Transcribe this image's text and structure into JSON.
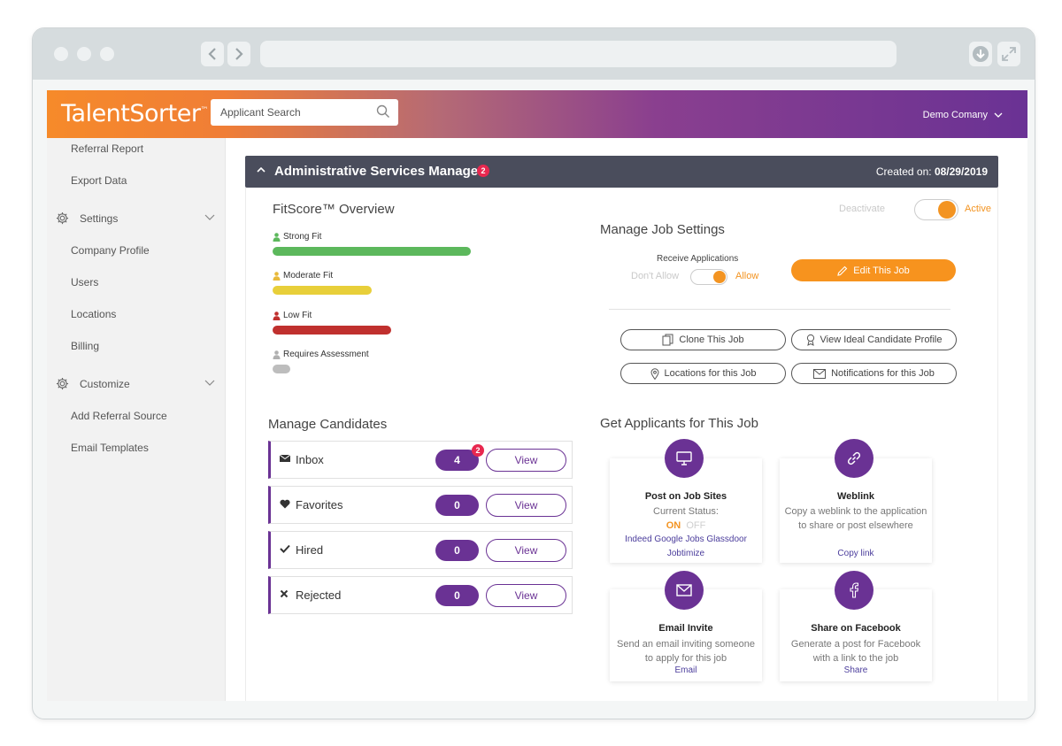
{
  "header": {
    "logo": "TalentSorter",
    "logo_tm": "™",
    "search_placeholder": "Applicant Search",
    "company": "Demo Comany"
  },
  "sidebar": {
    "items": [
      "Referral Report",
      "Export Data"
    ],
    "settings": {
      "label": "Settings",
      "items": [
        "Company Profile",
        "Users",
        "Locations",
        "Billing"
      ]
    },
    "customize": {
      "label": "Customize",
      "items": [
        "Add Referral Source",
        "Email Templates"
      ]
    }
  },
  "job": {
    "title": "Administrative Services Manager",
    "badge": "2",
    "created_label": "Created on:",
    "created_date": "08/29/2019"
  },
  "fitscore": {
    "title": "FitScore™ Overview",
    "rows": [
      {
        "label": "Strong Fit",
        "fraction": 1.0,
        "color": "#5cb85c"
      },
      {
        "label": "Moderate Fit",
        "fraction": 0.5,
        "color": "#e8cf3a"
      },
      {
        "label": "Low Fit",
        "fraction": 0.6,
        "color": "#c0302e"
      },
      {
        "label": "Requires Assessment",
        "fraction": 0.09,
        "color": "#bdbdbd"
      }
    ]
  },
  "status_toggle": {
    "off_label": "Deactivate",
    "on_label": "Active"
  },
  "job_settings": {
    "title": "Manage Job Settings",
    "receive_label": "Receive Applications",
    "dont_allow": "Don't Allow",
    "allow": "Allow",
    "edit_label": "Edit This Job",
    "buttons": {
      "clone": "Clone This Job",
      "ideal": "View Ideal Candidate Profile",
      "locations": "Locations for this Job",
      "notifications": "Notifications for this Job"
    }
  },
  "candidates": {
    "title": "Manage Candidates",
    "view_label": "View",
    "rows": [
      {
        "label": "Inbox",
        "count": "4",
        "badge": "2"
      },
      {
        "label": "Favorites",
        "count": "0"
      },
      {
        "label": "Hired",
        "count": "0"
      },
      {
        "label": "Rejected",
        "count": "0"
      }
    ]
  },
  "applicants": {
    "title": "Get Applicants for This Job",
    "post": {
      "title": "Post on Job Sites",
      "status_label": "Current Status:",
      "on": "ON",
      "off": "OFF",
      "sites_line1": "Indeed  Google Jobs  Glassdoor",
      "sites_line2": "Jobtimize"
    },
    "weblink": {
      "title": "Weblink",
      "desc": "Copy a weblink to the application to share or post elsewhere",
      "link": "Copy link"
    },
    "email": {
      "title": "Email Invite",
      "desc": "Send an email inviting someone to apply for this job",
      "link": "Email"
    },
    "facebook": {
      "title": "Share on Facebook",
      "desc": "Generate a post for Facebook with a link to the job",
      "link": "Share"
    }
  }
}
